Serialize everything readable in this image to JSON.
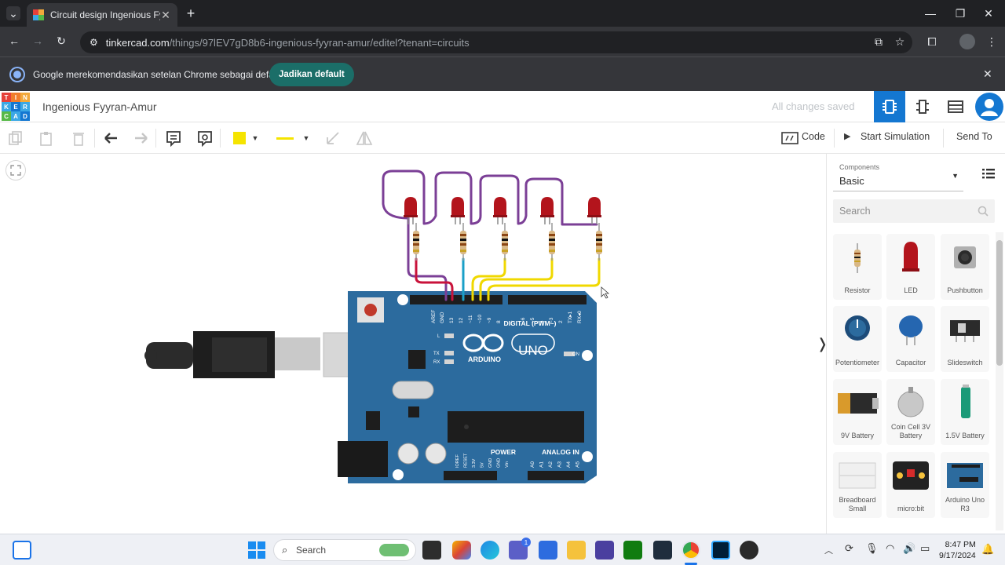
{
  "browser": {
    "tab_title": "Circuit design Ingenious Fyyran",
    "new_tab": "+",
    "close_tab": "✕",
    "url_domain": "tinkercad.com",
    "url_path": "/things/97lEV7gD8b6-ingenious-fyyran-amur/editel?tenant=circuits",
    "infobar_message": "Google merekomendasikan setelan Chrome sebagai default",
    "infobar_button": "Jadikan default"
  },
  "app": {
    "logo_letters": [
      "T",
      "I",
      "N",
      "K",
      "E",
      "R",
      "C",
      "A",
      "D"
    ],
    "project_name": "Ingenious Fyyran-Amur",
    "save_status": "All changes saved",
    "colors": {
      "accent": "#1477d1",
      "wire_purple": "#7b3f96",
      "wire_yellow": "#f0d800",
      "wire_red": "#c9133b",
      "wire_blue": "#1aa0c8",
      "board": "#2c6b9e"
    }
  },
  "toolbar": {
    "code_label": "Code",
    "start_simulation_label": "Start Simulation",
    "send_to_label": "Send To",
    "fill_color": "#f5e400",
    "line_color": "#f5e400"
  },
  "board": {
    "name": "UNO",
    "brand": "ARDUINO",
    "digital_label": "DIGITAL (PWM~)",
    "power_label": "POWER",
    "analog_label": "ANALOG IN",
    "on_label": "ON",
    "l_label": "L",
    "tx_label": "TX",
    "rx_label": "RX",
    "top_pins": [
      "AREF",
      "GND",
      "13",
      "12",
      "~11",
      "~10",
      "~9",
      "8",
      "7",
      "~6",
      "~5",
      "4",
      "~3",
      "2",
      "TX▸1",
      "RX◂0"
    ],
    "power_pins": [
      "IOREF",
      "RESET",
      "3.3V",
      "5V",
      "GND",
      "GND",
      "Vin"
    ],
    "analog_pins": [
      "A0",
      "A1",
      "A2",
      "A3",
      "A4",
      "A5"
    ]
  },
  "panel": {
    "components_label": "Components",
    "components_value": "Basic",
    "search_placeholder": "Search",
    "items": [
      {
        "label": "Resistor"
      },
      {
        "label": "LED"
      },
      {
        "label": "Pushbutton"
      },
      {
        "label": "Potentiometer"
      },
      {
        "label": "Capacitor"
      },
      {
        "label": "Slideswitch"
      },
      {
        "label": "9V Battery"
      },
      {
        "label": "Coin Cell 3V Battery"
      },
      {
        "label": "1.5V Battery"
      },
      {
        "label": "Breadboard Small"
      },
      {
        "label": "micro:bit"
      },
      {
        "label": "Arduino Uno R3"
      }
    ]
  },
  "taskbar": {
    "search_label": "Search",
    "time": "8:47 PM",
    "date": "9/17/2024",
    "teams_badge": "1"
  }
}
